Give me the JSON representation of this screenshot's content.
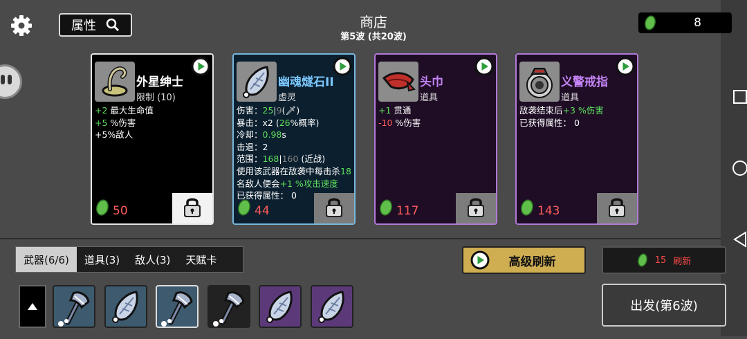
{
  "header": {
    "attr_label": "属性",
    "title": "商店",
    "subtitle": "第5波 (共20波)",
    "materials": "8"
  },
  "cards": [
    {
      "name": "外星绅士",
      "type": "限制 (10)",
      "price": "50",
      "rarity": "normal",
      "stats": [
        [
          {
            "t": "+2",
            "c": "g"
          },
          {
            "t": " 最大生命值"
          }
        ],
        [
          {
            "t": "+5",
            "c": "g"
          },
          {
            "t": " %伤害"
          }
        ],
        [
          {
            "t": "+5%敌人"
          }
        ]
      ]
    },
    {
      "name": "幽魂燧石II",
      "type": "虚灵",
      "price": "44",
      "rarity": "rare",
      "stats": [
        [
          {
            "t": "伤害："
          },
          {
            "t": "25",
            "c": "g"
          },
          {
            "t": "|"
          },
          {
            "t": "9",
            "c": "gr"
          },
          {
            "t": "(🗡)"
          }
        ],
        [
          {
            "t": "暴击：x2 ("
          },
          {
            "t": "26",
            "c": "g"
          },
          {
            "t": "%概率)"
          }
        ],
        [
          {
            "t": "冷却："
          },
          {
            "t": "0.98",
            "c": "g"
          },
          {
            "t": "s"
          }
        ],
        [
          {
            "t": "击退：2"
          }
        ],
        [
          {
            "t": "范围："
          },
          {
            "t": "168",
            "c": "g"
          },
          {
            "t": "|"
          },
          {
            "t": "160",
            "c": "gr"
          },
          {
            "t": " (近战)"
          }
        ],
        [
          {
            "t": "使用该武器在敌袭中每击杀"
          },
          {
            "t": "18",
            "c": "g"
          }
        ],
        [
          {
            "t": "名敌人便会"
          },
          {
            "t": "+1 %攻击速度",
            "c": "g"
          }
        ],
        [
          {
            "t": "已获得属性： 0"
          }
        ]
      ]
    },
    {
      "name": "头巾",
      "type": "道具",
      "price": "117",
      "rarity": "epic",
      "stats": [
        [
          {
            "t": "+1",
            "c": "g"
          },
          {
            "t": " 贯通"
          }
        ],
        [
          {
            "t": "-10",
            "c": "r"
          },
          {
            "t": " %伤害"
          }
        ]
      ]
    },
    {
      "name": "义警戒指",
      "type": "道具",
      "price": "143",
      "rarity": "epic",
      "stats": [
        [
          {
            "t": "敌袭结束后"
          },
          {
            "t": "+3 %伤害",
            "c": "g"
          }
        ],
        [
          {
            "t": "已获得属性： 0"
          }
        ]
      ]
    }
  ],
  "tabs": [
    "武器(6/6)",
    "道具(3)",
    "敌人(3)",
    "天赋卡"
  ],
  "active_tab": 0,
  "advanced_refresh_label": "高级刷新",
  "refresh": {
    "cost": "15",
    "label": "刷新"
  },
  "go_label": "出发(第6波)",
  "weapons": [
    {
      "icon": "hammer-icon",
      "color": "blue"
    },
    {
      "icon": "flint-icon",
      "color": "blue"
    },
    {
      "icon": "hammer-icon",
      "color": "blue",
      "selected": true
    },
    {
      "icon": "hammer-icon",
      "color": "dark"
    },
    {
      "icon": "flint-icon",
      "color": "purple"
    },
    {
      "icon": "flint-icon",
      "color": "purple"
    }
  ],
  "colors": {
    "material_green": "#5fbf4a",
    "price_red": "#ff5c5c",
    "stat_green": "#5ee05e",
    "rare_border": "#76b7de",
    "epic_border": "#b07ad6",
    "gold_button": "#cfae52"
  }
}
